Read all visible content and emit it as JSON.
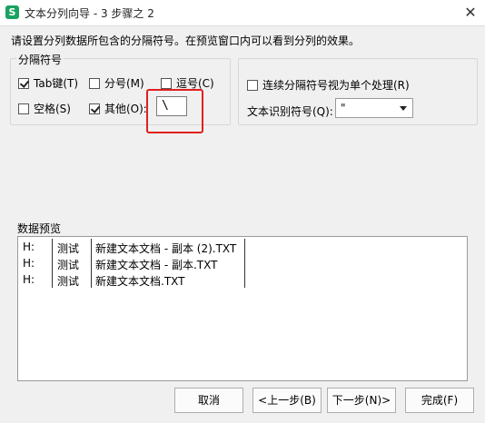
{
  "window": {
    "app_icon": "S",
    "title": "文本分列向导 - 3 步骤之 2",
    "close_glyph": "✕"
  },
  "instruction": "请设置分列数据所包含的分隔符号。在预览窗口内可以看到分列的效果。",
  "delimiters": {
    "group_label": "分隔符号",
    "tab": {
      "label": "Tab键(T)",
      "checked": true
    },
    "semicolon": {
      "label": "分号(M)",
      "checked": false
    },
    "comma": {
      "label": "逗号(C)",
      "checked": false
    },
    "space": {
      "label": "空格(S)",
      "checked": false
    },
    "other": {
      "label": "其他(O):",
      "checked": true,
      "value": "\\"
    }
  },
  "options": {
    "consecutive": {
      "label": "连续分隔符号视为单个处理(R)",
      "checked": false
    },
    "qualifier_label": "文本识别符号(Q):",
    "qualifier_value": "\""
  },
  "preview": {
    "label": "数据预览",
    "rows": [
      [
        "H:",
        "测试",
        "新建文本文档 - 副本 (2).TXT"
      ],
      [
        "H:",
        "测试",
        "新建文本文档 - 副本.TXT"
      ],
      [
        "H:",
        "测试",
        "新建文本文档.TXT"
      ]
    ]
  },
  "buttons": {
    "cancel": "取消",
    "back": "<上一步(B)",
    "next": "下一步(N)>",
    "finish": "完成(F)"
  }
}
